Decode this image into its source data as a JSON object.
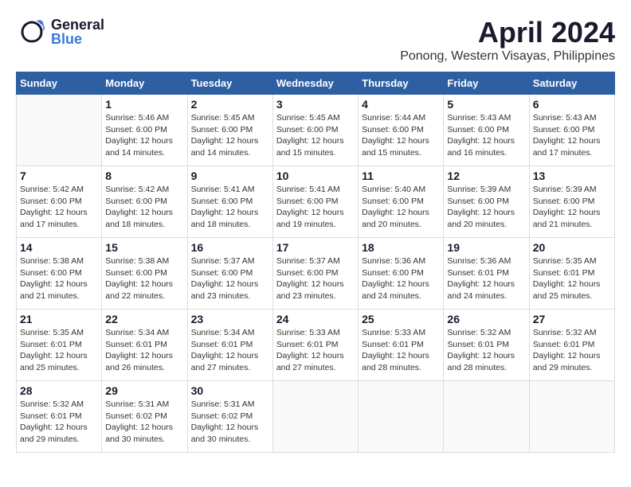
{
  "header": {
    "logo_general": "General",
    "logo_blue": "Blue",
    "month_title": "April 2024",
    "location": "Ponong, Western Visayas, Philippines"
  },
  "days_of_week": [
    "Sunday",
    "Monday",
    "Tuesday",
    "Wednesday",
    "Thursday",
    "Friday",
    "Saturday"
  ],
  "weeks": [
    [
      {
        "day": "",
        "info": ""
      },
      {
        "day": "1",
        "info": "Sunrise: 5:46 AM\nSunset: 6:00 PM\nDaylight: 12 hours\nand 14 minutes."
      },
      {
        "day": "2",
        "info": "Sunrise: 5:45 AM\nSunset: 6:00 PM\nDaylight: 12 hours\nand 14 minutes."
      },
      {
        "day": "3",
        "info": "Sunrise: 5:45 AM\nSunset: 6:00 PM\nDaylight: 12 hours\nand 15 minutes."
      },
      {
        "day": "4",
        "info": "Sunrise: 5:44 AM\nSunset: 6:00 PM\nDaylight: 12 hours\nand 15 minutes."
      },
      {
        "day": "5",
        "info": "Sunrise: 5:43 AM\nSunset: 6:00 PM\nDaylight: 12 hours\nand 16 minutes."
      },
      {
        "day": "6",
        "info": "Sunrise: 5:43 AM\nSunset: 6:00 PM\nDaylight: 12 hours\nand 17 minutes."
      }
    ],
    [
      {
        "day": "7",
        "info": "Sunrise: 5:42 AM\nSunset: 6:00 PM\nDaylight: 12 hours\nand 17 minutes."
      },
      {
        "day": "8",
        "info": "Sunrise: 5:42 AM\nSunset: 6:00 PM\nDaylight: 12 hours\nand 18 minutes."
      },
      {
        "day": "9",
        "info": "Sunrise: 5:41 AM\nSunset: 6:00 PM\nDaylight: 12 hours\nand 18 minutes."
      },
      {
        "day": "10",
        "info": "Sunrise: 5:41 AM\nSunset: 6:00 PM\nDaylight: 12 hours\nand 19 minutes."
      },
      {
        "day": "11",
        "info": "Sunrise: 5:40 AM\nSunset: 6:00 PM\nDaylight: 12 hours\nand 20 minutes."
      },
      {
        "day": "12",
        "info": "Sunrise: 5:39 AM\nSunset: 6:00 PM\nDaylight: 12 hours\nand 20 minutes."
      },
      {
        "day": "13",
        "info": "Sunrise: 5:39 AM\nSunset: 6:00 PM\nDaylight: 12 hours\nand 21 minutes."
      }
    ],
    [
      {
        "day": "14",
        "info": "Sunrise: 5:38 AM\nSunset: 6:00 PM\nDaylight: 12 hours\nand 21 minutes."
      },
      {
        "day": "15",
        "info": "Sunrise: 5:38 AM\nSunset: 6:00 PM\nDaylight: 12 hours\nand 22 minutes."
      },
      {
        "day": "16",
        "info": "Sunrise: 5:37 AM\nSunset: 6:00 PM\nDaylight: 12 hours\nand 23 minutes."
      },
      {
        "day": "17",
        "info": "Sunrise: 5:37 AM\nSunset: 6:00 PM\nDaylight: 12 hours\nand 23 minutes."
      },
      {
        "day": "18",
        "info": "Sunrise: 5:36 AM\nSunset: 6:00 PM\nDaylight: 12 hours\nand 24 minutes."
      },
      {
        "day": "19",
        "info": "Sunrise: 5:36 AM\nSunset: 6:01 PM\nDaylight: 12 hours\nand 24 minutes."
      },
      {
        "day": "20",
        "info": "Sunrise: 5:35 AM\nSunset: 6:01 PM\nDaylight: 12 hours\nand 25 minutes."
      }
    ],
    [
      {
        "day": "21",
        "info": "Sunrise: 5:35 AM\nSunset: 6:01 PM\nDaylight: 12 hours\nand 25 minutes."
      },
      {
        "day": "22",
        "info": "Sunrise: 5:34 AM\nSunset: 6:01 PM\nDaylight: 12 hours\nand 26 minutes."
      },
      {
        "day": "23",
        "info": "Sunrise: 5:34 AM\nSunset: 6:01 PM\nDaylight: 12 hours\nand 27 minutes."
      },
      {
        "day": "24",
        "info": "Sunrise: 5:33 AM\nSunset: 6:01 PM\nDaylight: 12 hours\nand 27 minutes."
      },
      {
        "day": "25",
        "info": "Sunrise: 5:33 AM\nSunset: 6:01 PM\nDaylight: 12 hours\nand 28 minutes."
      },
      {
        "day": "26",
        "info": "Sunrise: 5:32 AM\nSunset: 6:01 PM\nDaylight: 12 hours\nand 28 minutes."
      },
      {
        "day": "27",
        "info": "Sunrise: 5:32 AM\nSunset: 6:01 PM\nDaylight: 12 hours\nand 29 minutes."
      }
    ],
    [
      {
        "day": "28",
        "info": "Sunrise: 5:32 AM\nSunset: 6:01 PM\nDaylight: 12 hours\nand 29 minutes."
      },
      {
        "day": "29",
        "info": "Sunrise: 5:31 AM\nSunset: 6:02 PM\nDaylight: 12 hours\nand 30 minutes."
      },
      {
        "day": "30",
        "info": "Sunrise: 5:31 AM\nSunset: 6:02 PM\nDaylight: 12 hours\nand 30 minutes."
      },
      {
        "day": "",
        "info": ""
      },
      {
        "day": "",
        "info": ""
      },
      {
        "day": "",
        "info": ""
      },
      {
        "day": "",
        "info": ""
      }
    ]
  ]
}
